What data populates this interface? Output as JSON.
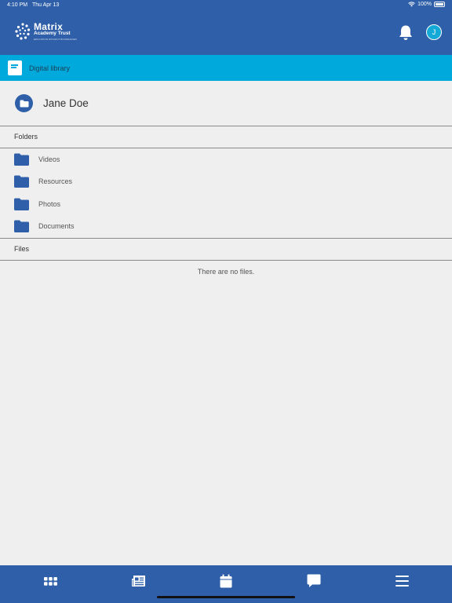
{
  "status_bar": {
    "time": "4:10 PM",
    "date": "Thu Apr 13",
    "battery": "100%"
  },
  "header": {
    "logo": {
      "line1": "Matrix",
      "line2": "Academy Trust",
      "line3": "EDUCATION WITHOUT BOUNDARIES"
    },
    "avatar_initial": "J"
  },
  "library_bar": {
    "title": "Digital library",
    "icon": "book-icon"
  },
  "user": {
    "name": "Jane Doe",
    "icon": "folder-icon"
  },
  "folders_section": {
    "label": "Folders",
    "items": [
      {
        "label": "Videos"
      },
      {
        "label": "Resources"
      },
      {
        "label": "Photos"
      },
      {
        "label": "Documents"
      }
    ]
  },
  "files_section": {
    "label": "Files",
    "empty_message": "There are no files."
  },
  "tab_bar": {
    "tabs": [
      {
        "icon": "grid-icon"
      },
      {
        "icon": "newspaper-icon"
      },
      {
        "icon": "calendar-icon"
      },
      {
        "icon": "chat-icon"
      },
      {
        "icon": "menu-icon"
      }
    ]
  },
  "colors": {
    "header": "#2e5fa8",
    "accent_bar": "#00a9dc",
    "background": "#efefef",
    "folder": "#2e5fa8"
  }
}
